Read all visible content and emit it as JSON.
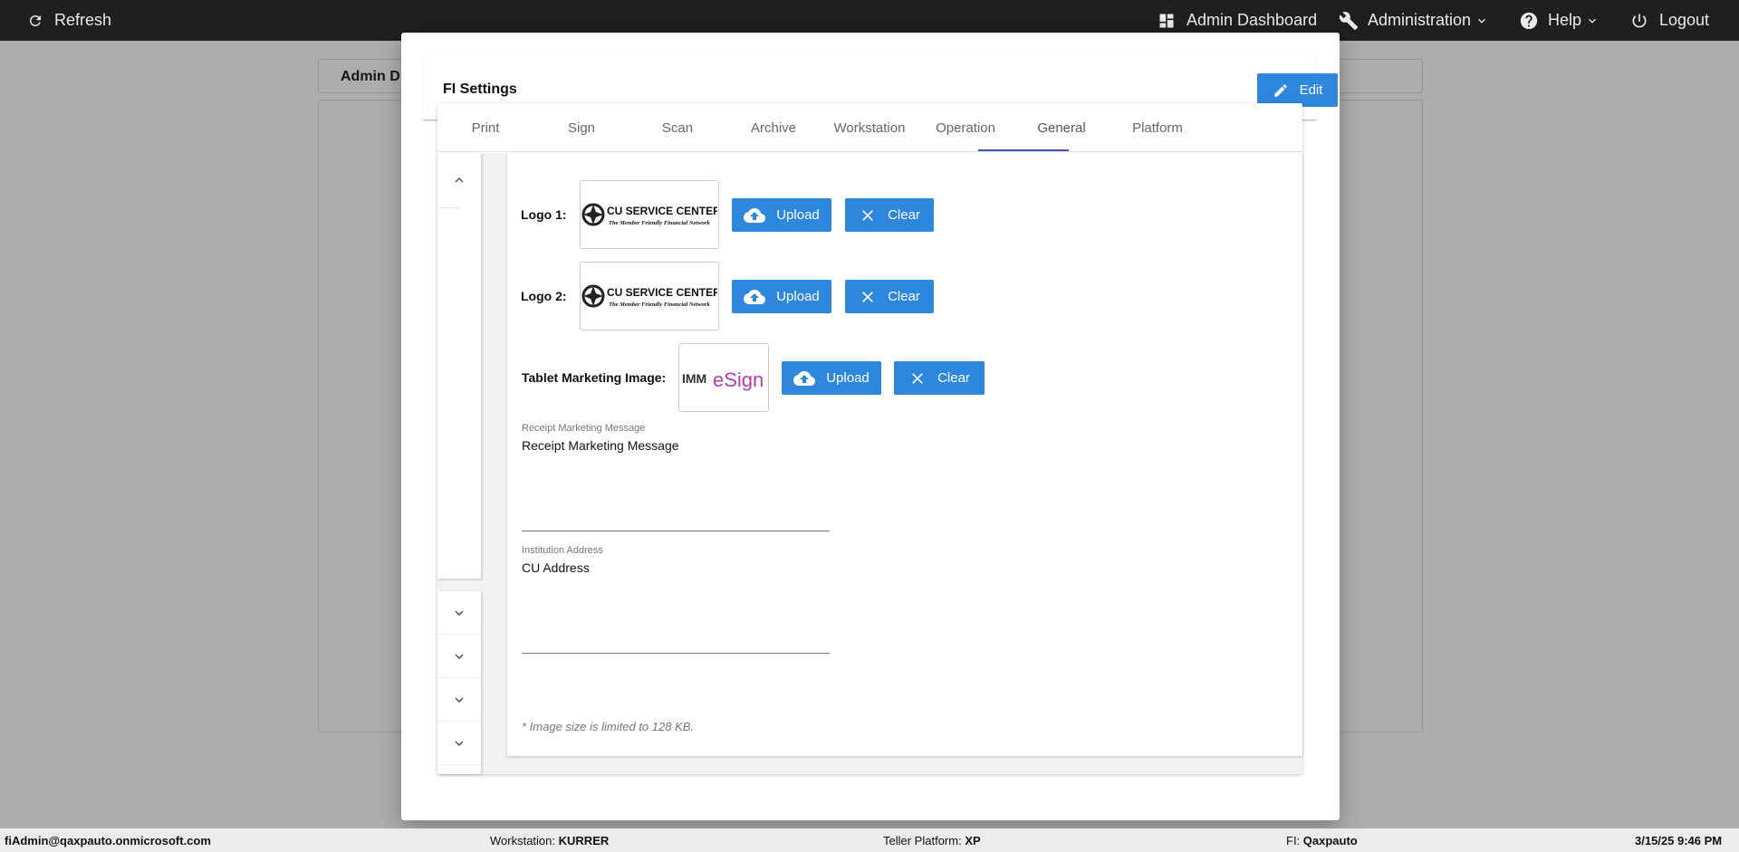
{
  "topbar": {
    "refresh": "Refresh",
    "admin_dashboard": "Admin Dashboard",
    "administration": "Administration",
    "help": "Help",
    "logout": "Logout"
  },
  "background": {
    "card_title": "Admin D"
  },
  "modal": {
    "title": "FI Settings",
    "edit_label": "Edit",
    "tabs": [
      {
        "label": "Print",
        "active": false
      },
      {
        "label": "Sign",
        "active": false
      },
      {
        "label": "Scan",
        "active": false
      },
      {
        "label": "Archive",
        "active": false
      },
      {
        "label": "Workstation",
        "active": false
      },
      {
        "label": "Operation",
        "active": false
      },
      {
        "label": "General",
        "active": true
      },
      {
        "label": "Platform",
        "active": false
      }
    ],
    "general": {
      "logo1_label": "Logo 1:",
      "logo2_label": "Logo 2:",
      "tablet_label": "Tablet Marketing Image:",
      "upload_label": "Upload",
      "clear_label": "Clear",
      "logo_text_main": "CU SERVICE CENTERS",
      "logo_text_sub": "The Member Friendly Financial Network",
      "tablet_img_left": "IMM",
      "tablet_img_right": "eSign",
      "receipt_field_label": "Receipt Marketing Message",
      "receipt_field_value": "Receipt Marketing Message",
      "address_field_label": "Institution Address",
      "address_field_value": "CU Address",
      "note": "* Image size is limited to 128 KB."
    }
  },
  "statusbar": {
    "user": "fiAdmin@qaxpauto.onmicrosoft.com",
    "workstation_label": "Workstation:",
    "workstation_value": "KURRER",
    "platform_label": "Teller Platform:",
    "platform_value": "XP",
    "fi_label": "FI:",
    "fi_value": "Qaxpauto",
    "datetime": "3/15/25 9:46 PM"
  },
  "colors": {
    "accent": "#2d87dc",
    "tab_indicator": "#4a55b8",
    "topbar": "#1f1f1f"
  }
}
